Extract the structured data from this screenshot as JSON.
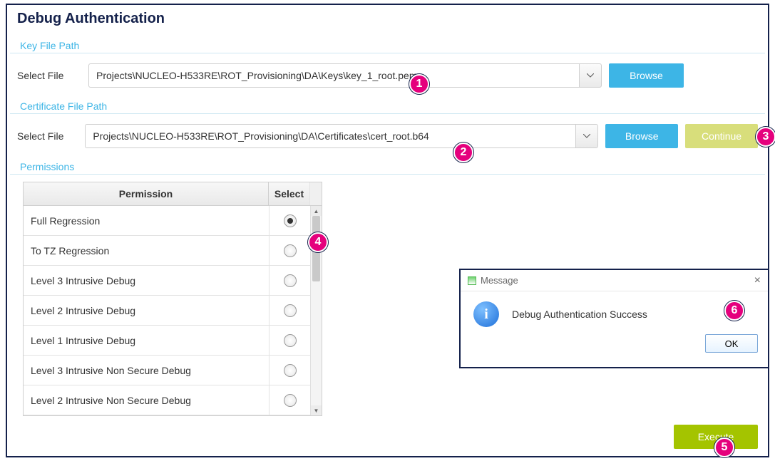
{
  "panel": {
    "title": "Debug Authentication"
  },
  "sections": {
    "keyfile": "Key File Path",
    "certfile": "Certificate File Path",
    "permissions": "Permissions"
  },
  "labels": {
    "select_file": "Select File",
    "browse": "Browse",
    "continue": "Continue",
    "execute": "Execute"
  },
  "paths": {
    "key": "Projects\\NUCLEO-H533RE\\ROT_Provisioning\\DA\\Keys\\key_1_root.pem",
    "cert": "Projects\\NUCLEO-H533RE\\ROT_Provisioning\\DA\\Certificates\\cert_root.b64"
  },
  "perm": {
    "hdr_perm": "Permission",
    "hdr_sel": "Select",
    "rows": [
      {
        "label": "Full Regression",
        "selected": true
      },
      {
        "label": "To TZ Regression",
        "selected": false
      },
      {
        "label": "Level 3 Intrusive Debug",
        "selected": false
      },
      {
        "label": "Level 2 Intrusive Debug",
        "selected": false
      },
      {
        "label": "Level 1 Intrusive Debug",
        "selected": false
      },
      {
        "label": "Level 3 Intrusive Non Secure Debug",
        "selected": false
      },
      {
        "label": "Level 2 Intrusive Non Secure Debug",
        "selected": false
      }
    ]
  },
  "msg": {
    "title": "Message",
    "text": "Debug Authentication Success",
    "ok": "OK"
  },
  "callouts": {
    "1": "1",
    "2": "2",
    "3": "3",
    "4": "4",
    "5": "5",
    "6": "6"
  },
  "colors": {
    "accent_blue": "#3db5e6",
    "accent_olive": "#a4c400",
    "brand_dark": "#14214b",
    "callout": "#e5007d"
  }
}
